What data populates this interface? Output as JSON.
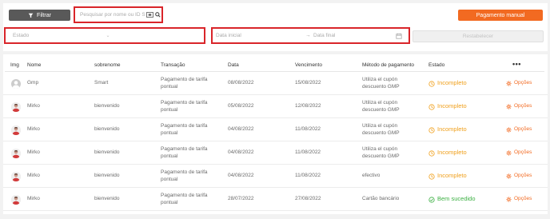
{
  "toolbar": {
    "filter_label": "Filtrar",
    "search_placeholder": "Pesquisar por nome ou ID S",
    "primary_label": "Pagamento manual"
  },
  "filters": {
    "estado_placeholder": "Estado",
    "date_start_placeholder": "Data inicial",
    "date_end_placeholder": "Data final",
    "reset_label": "Restabelecer"
  },
  "table": {
    "headers": {
      "img": "Img",
      "nome": "Nome",
      "sobrenome": "sobrenome",
      "transacao": "Transação",
      "data": "Data",
      "vencimento": "Vencimento",
      "metodo": "Método de pagamento",
      "estado": "Estado",
      "more": "•••"
    },
    "rows": [
      {
        "avatar": "generic",
        "nome": "Gmp",
        "sobrenome": "Smart",
        "transacao_1": "Pagamento de tarifa",
        "transacao_2": "pontual",
        "data": "08/08/2022",
        "vencimento": "15/08/2022",
        "metodo_1": "Utiliza el cupón",
        "metodo_2": "descuento GMP",
        "estado": "Incompleto",
        "estado_type": "incomplete",
        "acao": "Opções"
      },
      {
        "avatar": "photo",
        "nome": "Mirko",
        "sobrenome": "bienvenido",
        "transacao_1": "Pagamento de tarifa",
        "transacao_2": "pontual",
        "data": "05/08/2022",
        "vencimento": "12/08/2022",
        "metodo_1": "Utiliza el cupón",
        "metodo_2": "descuento GMP",
        "estado": "Incompleto",
        "estado_type": "incomplete",
        "acao": "Opções"
      },
      {
        "avatar": "photo",
        "nome": "Mirko",
        "sobrenome": "bienvenido",
        "transacao_1": "Pagamento de tarifa",
        "transacao_2": "pontual",
        "data": "04/08/2022",
        "vencimento": "11/08/2022",
        "metodo_1": "Utiliza el cupón",
        "metodo_2": "descuento GMP",
        "estado": "Incompleto",
        "estado_type": "incomplete",
        "acao": "Opções"
      },
      {
        "avatar": "photo",
        "nome": "Mirko",
        "sobrenome": "bienvenido",
        "transacao_1": "Pagamento de tarifa",
        "transacao_2": "pontual",
        "data": "04/08/2022",
        "vencimento": "11/08/2022",
        "metodo_1": "Utiliza el cupón",
        "metodo_2": "descuento GMP",
        "estado": "Incompleto",
        "estado_type": "incomplete",
        "acao": "Opções"
      },
      {
        "avatar": "photo",
        "nome": "Mirko",
        "sobrenome": "bienvenido",
        "transacao_1": "Pagamento de tarifa",
        "transacao_2": "pontual",
        "data": "04/08/2022",
        "vencimento": "11/08/2022",
        "metodo_1": "efectivo",
        "metodo_2": "",
        "estado": "Incompleto",
        "estado_type": "incomplete",
        "acao": "Opções"
      },
      {
        "avatar": "photo",
        "nome": "Mirko",
        "sobrenome": "bienvenido",
        "transacao_1": "Pagamento de tarifa",
        "transacao_2": "pontual",
        "data": "28/07/2022",
        "vencimento": "27/08/2022",
        "metodo_1": "Cartão bancário",
        "metodo_2": "",
        "estado": "Bem sucedido",
        "estado_type": "success",
        "acao": "Opções"
      }
    ]
  },
  "colors": {
    "accent": "#f26a21",
    "highlight_border": "#d9252a",
    "incomplete": "#f0a01c",
    "success": "#3cb043",
    "filter_button": "#595959"
  },
  "icons": {
    "filter": "funnel-icon",
    "search": "search-icon",
    "qr": "qr-scan-icon",
    "calendar": "calendar-icon",
    "chevron": "chevron-down-icon",
    "incomplete": "clock-icon",
    "success": "check-circle-icon",
    "options": "gear-icon"
  }
}
